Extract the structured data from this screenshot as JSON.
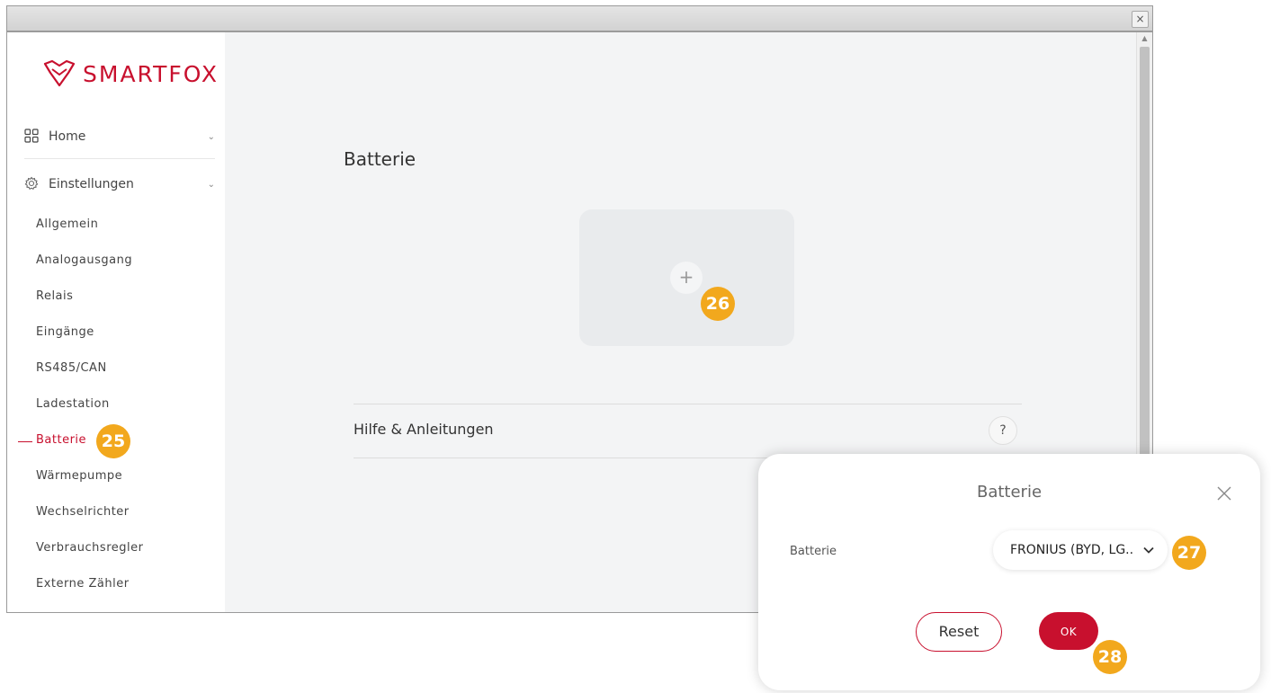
{
  "window": {
    "close_glyph": "×"
  },
  "sidebar": {
    "logo_text": "SMARTFOX",
    "nav": [
      {
        "label": "Home",
        "icon": "grid-icon"
      },
      {
        "label": "Einstellungen",
        "icon": "gear-icon"
      }
    ],
    "sub_items": [
      "Allgemein",
      "Analogausgang",
      "Relais",
      "Eingänge",
      "RS485/CAN",
      "Ladestation",
      "Batterie",
      "Wärmepumpe",
      "Wechselrichter",
      "Verbrauchsregler",
      "Externe Zähler"
    ],
    "active_item": "Batterie"
  },
  "main": {
    "title": "Batterie",
    "add_glyph": "+",
    "help_label": "Hilfe & Anleitungen",
    "help_glyph": "?"
  },
  "modal": {
    "title": "Batterie",
    "field_label": "Batterie",
    "select_value": "FRONIUS (BYD, LG..",
    "reset_label": "Reset",
    "ok_label": "OK"
  },
  "markers": [
    "25",
    "26",
    "27",
    "28"
  ],
  "colors": {
    "brand": "#c8102e",
    "marker": "#f2a81d"
  }
}
